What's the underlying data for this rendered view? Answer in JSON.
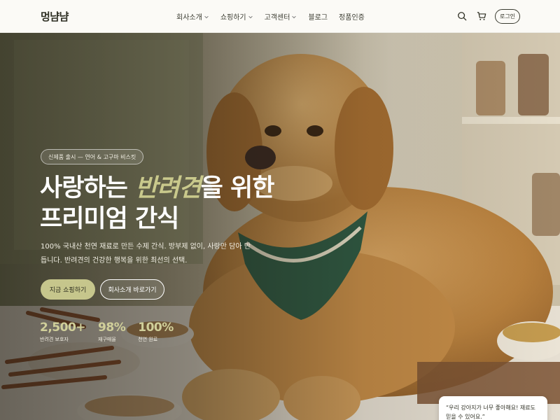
{
  "brand": {
    "logo": "멍냠냠"
  },
  "nav": {
    "items": [
      {
        "label": "회사소개",
        "has_dropdown": true
      },
      {
        "label": "쇼핑하기",
        "has_dropdown": true
      },
      {
        "label": "고객센터",
        "has_dropdown": true
      },
      {
        "label": "블로그",
        "has_dropdown": false
      },
      {
        "label": "정품인증",
        "has_dropdown": false
      }
    ]
  },
  "header": {
    "search_icon": "search-icon",
    "cart_icon": "cart-icon",
    "login_label": "로그인"
  },
  "hero": {
    "badge": "신제품 출시 — 연어 & 고구마 비스킷",
    "headline_line1_pre": "사랑하는 ",
    "headline_line1_accent": "반려견",
    "headline_line1_post": "을 위한",
    "headline_line2": "프리미엄 간식",
    "subtext": "100% 국내산 천연 재료로 만든 수제 간식. 방부제 없이, 사랑만 담아 만듭니다. 반려견의 건강한 행복을 위한 최선의 선택.",
    "primary_button": "지금 쇼핑하기",
    "secondary_button": "회사소개 바로가기",
    "stats": [
      {
        "value": "2,500+",
        "label": "반려견 보호자"
      },
      {
        "value": "98%",
        "label": "재구매율"
      },
      {
        "value": "100%",
        "label": "천연 원료"
      }
    ]
  },
  "testimonial": {
    "text": "“우리 강아지가 너무 좋아해요! 재료도 믿을 수 있어요.”"
  },
  "colors": {
    "accent": "#c6c68c",
    "accent_text": "#c9c98c",
    "header_bg": "#fbfaf6",
    "text_dark": "#2f3024"
  }
}
